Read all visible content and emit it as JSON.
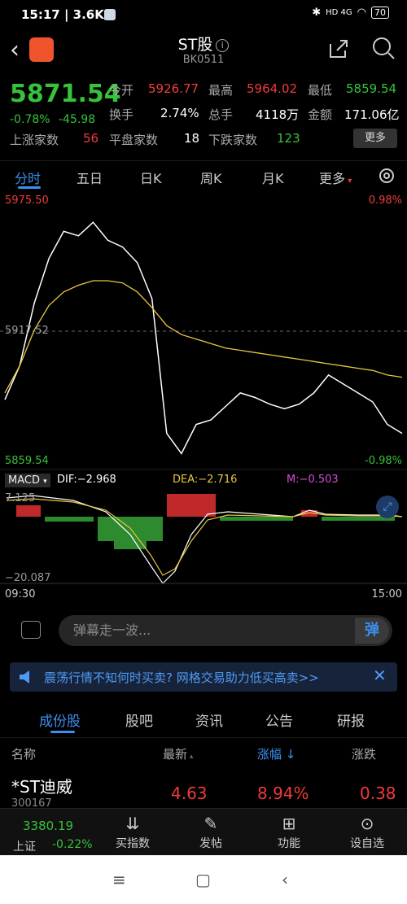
{
  "status": {
    "time": "15:17 | 3.6K/s",
    "network": "HD 4G",
    "battery": "70"
  },
  "header": {
    "title": "ST股",
    "code": "BK0511"
  },
  "quote": {
    "price": "5871.54",
    "change_pct": "-0.78%",
    "change_abs": "-45.98",
    "row1": [
      {
        "label": "今开",
        "value": "5926.77",
        "color": "red"
      },
      {
        "label": "最高",
        "value": "5964.02",
        "color": "red"
      },
      {
        "label": "最低",
        "value": "5859.54",
        "color": "green"
      }
    ],
    "row2": [
      {
        "label": "换手",
        "value": "2.74%",
        "color": "white"
      },
      {
        "label": "总手",
        "value": "4118万",
        "color": "white"
      },
      {
        "label": "金额",
        "value": "171.06亿",
        "color": "white"
      }
    ],
    "row3": [
      {
        "label": "上涨家数",
        "value": "56",
        "color": "red"
      },
      {
        "label": "平盘家数",
        "value": "18",
        "color": "white"
      },
      {
        "label": "下跌家数",
        "value": "123",
        "color": "green"
      }
    ],
    "more": "更多"
  },
  "tabs": [
    "分时",
    "五日",
    "日K",
    "周K",
    "月K",
    "更多"
  ],
  "chart": {
    "top_price": "5975.50",
    "top_pct": "0.98%",
    "mid_price": "5917.52",
    "bottom_price": "5859.54",
    "bottom_pct": "-0.98%",
    "macd_label": "MACD",
    "dif": "DIF:−2.968",
    "dea": "DEA:−2.716",
    "m": "M:−0.503",
    "macd_top": "7.125",
    "macd_bottom": "−20.087",
    "time_start": "09:30",
    "time_end": "15:00"
  },
  "chart_data": {
    "type": "line",
    "ylim": [
      5859.54,
      5975.5
    ],
    "series": [
      {
        "values": [
          5887,
          5902,
          5930,
          5950,
          5962,
          5960,
          5966,
          5958,
          5955,
          5948,
          5932,
          5872,
          5863,
          5876,
          5878,
          5884,
          5890,
          5888,
          5885,
          5883,
          5885,
          5890,
          5898,
          5894,
          5890,
          5886,
          5876,
          5872
        ]
      },
      {
        "values": [
          5890,
          5902,
          5918,
          5929,
          5935,
          5938,
          5940,
          5940,
          5939,
          5935,
          5928,
          5920,
          5916,
          5914,
          5912,
          5910,
          5909,
          5908,
          5907,
          5906,
          5905,
          5904,
          5903,
          5902,
          5901,
          5900,
          5898,
          5897
        ]
      }
    ]
  },
  "comment": {
    "placeholder": "弹幕走一波...",
    "button": "弹"
  },
  "banner": {
    "text": "震荡行情不知何时买卖? 网格交易助力低买高卖>>"
  },
  "lower_tabs": [
    "成份股",
    "股吧",
    "资讯",
    "公告",
    "研报"
  ],
  "table": {
    "headers": [
      "名称",
      "最新",
      "涨幅 ↓",
      "涨跌"
    ],
    "rows": [
      {
        "name": "*ST迪威",
        "code": "300167",
        "latest": "4.63",
        "pct": "8.94%",
        "chg": "0.38"
      }
    ]
  },
  "toolbar": {
    "index_value": "3380.19",
    "index_name": "上证",
    "index_pct": "-0.22%",
    "items": [
      "买指数",
      "发帖",
      "功能",
      "设自选"
    ]
  }
}
